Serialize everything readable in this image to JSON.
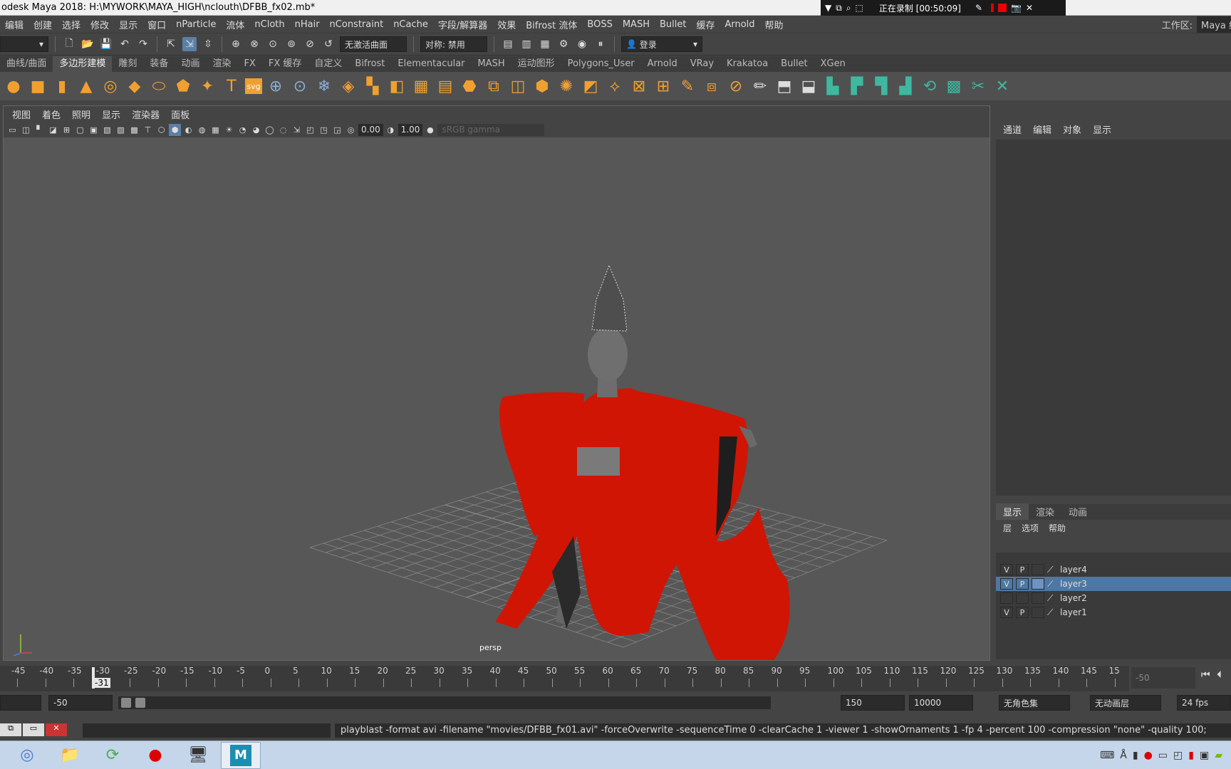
{
  "window": {
    "title": "odesk Maya 2018: H:\\MYWORK\\MAYA_HIGH\\nclouth\\DFBB_fx02.mb*"
  },
  "recorder": {
    "status": "正在录制 [00:50:09]"
  },
  "menubar": {
    "items": [
      "编辑",
      "创建",
      "选择",
      "修改",
      "显示",
      "窗口",
      "nParticle",
      "流体",
      "nCloth",
      "nHair",
      "nConstraint",
      "nCache",
      "字段/解算器",
      "效果",
      "Bifrost 流体",
      "BOSS",
      "MASH",
      "Bullet",
      "缓存",
      "Arnold",
      "帮助"
    ]
  },
  "workspace": {
    "label": "工作区:",
    "value": "Maya 经典"
  },
  "statusline": {
    "live_surface": "无激活曲面",
    "symmetry": "对称: 禁用",
    "login": "登录"
  },
  "shelf": {
    "tabs": [
      "曲线/曲面",
      "多边形建模",
      "雕刻",
      "装备",
      "动画",
      "渲染",
      "FX",
      "FX 缓存",
      "自定义",
      "Bifrost",
      "Elementacular",
      "MASH",
      "运动图形",
      "Polygons_User",
      "Arnold",
      "VRay",
      "Krakatoa",
      "Bullet",
      "XGen"
    ],
    "active_tab": 1,
    "icons": [
      "sphere-icon",
      "cube-icon",
      "cylinder-icon",
      "cone-icon",
      "torus-icon",
      "plane-icon",
      "disc-icon",
      "platonic-icon",
      "super-shape-icon",
      "text-icon",
      "svg-icon",
      "measure-icon",
      "transform-icon",
      "snowflake-icon",
      "combine-icon",
      "separate-icon",
      "mirror-icon",
      "extrude-icon",
      "bridge-icon",
      "bevel-icon",
      "fill-hole-icon",
      "append-icon",
      "multi-cut-icon",
      "loop-icon",
      "insert-edge-icon",
      "target-weld-icon",
      "bevel2-icon",
      "quad-draw-icon",
      "slide-icon",
      "bridge2-icon",
      "smooth-icon",
      "pencil-icon",
      "edge-loop-icon",
      "knife-icon",
      "uv-editor-icon",
      "unfold-icon",
      "planar-icon",
      "camera-uv-icon",
      "auto-uv-icon",
      "checker-icon",
      "cut-uv-icon",
      "sew-uv-icon"
    ]
  },
  "viewport": {
    "menu": [
      "视图",
      "着色",
      "照明",
      "显示",
      "渲染器",
      "面板"
    ],
    "exposure": "0.00",
    "gamma_value": "1.00",
    "color_space": "sRGB gamma",
    "camera_label": "persp",
    "cloth_color": "#d01505",
    "skin_color": "#6a6a6a",
    "grid_color": "#8a8a8a"
  },
  "channelbox": {
    "menu": [
      "通道",
      "编辑",
      "对象",
      "显示"
    ]
  },
  "layer_editor": {
    "tabs": [
      "显示",
      "渲染",
      "动画"
    ],
    "active_tab": 0,
    "menu": [
      "层",
      "选项",
      "帮助"
    ],
    "layers": [
      {
        "name": "layer4",
        "v": "V",
        "p": "P",
        "selected": false
      },
      {
        "name": "layer3",
        "v": "V",
        "p": "P",
        "selected": true
      },
      {
        "name": "layer2",
        "v": "",
        "p": "",
        "selected": false
      },
      {
        "name": "layer1",
        "v": "V",
        "p": "P",
        "selected": false
      }
    ],
    "selection_color": "#4d78a5"
  },
  "timeslider": {
    "ticks": [
      "-45",
      "-40",
      "-35",
      "-30",
      "-25",
      "-20",
      "-15",
      "-10",
      "-5",
      "0",
      "5",
      "10",
      "15",
      "20",
      "25",
      "30",
      "35",
      "40",
      "45",
      "50",
      "55",
      "60",
      "65",
      "70",
      "75",
      "80",
      "85",
      "90",
      "95",
      "100",
      "105",
      "110",
      "115",
      "120",
      "125",
      "130",
      "135",
      "140",
      "145",
      "15"
    ],
    "current_frame": "-31",
    "current_field": "-50"
  },
  "range": {
    "start": "-50",
    "end": "150",
    "max_end": "10000",
    "character_set": "无角色集",
    "anim_layer": "无动画层",
    "fps": "24 fps"
  },
  "command_line": {
    "text": "playblast  -format avi -filename \"movies/DFBB_fx01.avi\" -forceOverwrite  -sequenceTime 0 -clearCache 1 -viewer 1 -showOrnaments 1 -fp 4 -percent 100 -compression \"none\" -quality 100;"
  },
  "taskbar": {
    "apps": [
      "daemon-tools-icon",
      "file-explorer-icon",
      "browser-icon",
      "record-icon",
      "terminal-icon",
      "maya-icon"
    ],
    "maya_label": "MAYA"
  }
}
